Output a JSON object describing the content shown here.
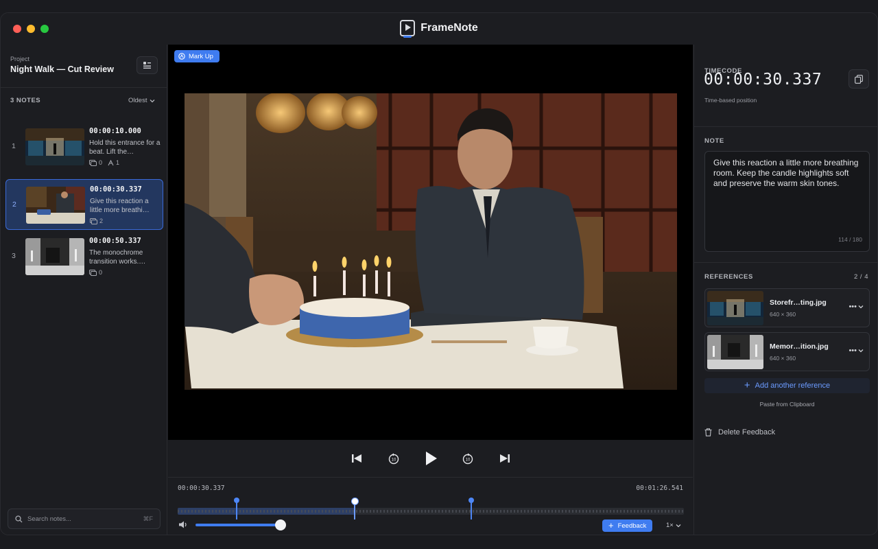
{
  "app": {
    "title": "FrameNote"
  },
  "project": {
    "label": "Project",
    "name": "Night Walk — Cut Review"
  },
  "notes_header": {
    "count_label": "3 NOTES",
    "sort_label": "Oldest"
  },
  "notes": [
    {
      "index": "1",
      "time": "00:00:10.000",
      "text": "Hold this entrance for a beat. Lift the…",
      "comments": "0",
      "attachments": "1"
    },
    {
      "index": "2",
      "time": "00:00:30.337",
      "text": "Give this reaction a little more breathi…",
      "comments": "2"
    },
    {
      "index": "3",
      "time": "00:00:50.337",
      "text": "The monochrome transition works.…",
      "comments": "0"
    }
  ],
  "search": {
    "placeholder": "Search notes...",
    "shortcut": "⌘F"
  },
  "viewer": {
    "markup_label": "Mark Up"
  },
  "timeline": {
    "current": "00:00:30.337",
    "duration": "00:01:26.541",
    "played_fraction": 0.35,
    "marker_fractions": [
      0.116,
      0.35,
      0.58
    ],
    "volume_fraction": 1.0,
    "feedback_label": "Feedback",
    "speed": "1×"
  },
  "inspector": {
    "timecode_title": "TIMECODE",
    "timecode": "00:00:30.337",
    "timecode_sub": "Time-based position",
    "note_title": "NOTE",
    "note_text": "Give this reaction a little more breathing room. Keep the candle highlights soft and preserve the warm skin tones.",
    "note_count": "114 / 180",
    "references_title": "REFERENCES",
    "references_count": "2 / 4",
    "references": [
      {
        "name": "Storefr…ting.jpg",
        "size": "640 × 360"
      },
      {
        "name": "Memor…ition.jpg",
        "size": "640 × 360"
      }
    ],
    "add_reference": "Add another reference",
    "paste": "Paste from Clipboard",
    "delete": "Delete Feedback"
  },
  "colors": {
    "accent": "#3f7cf0",
    "selected_bg": "#23375f",
    "background": "#1c1d21"
  }
}
